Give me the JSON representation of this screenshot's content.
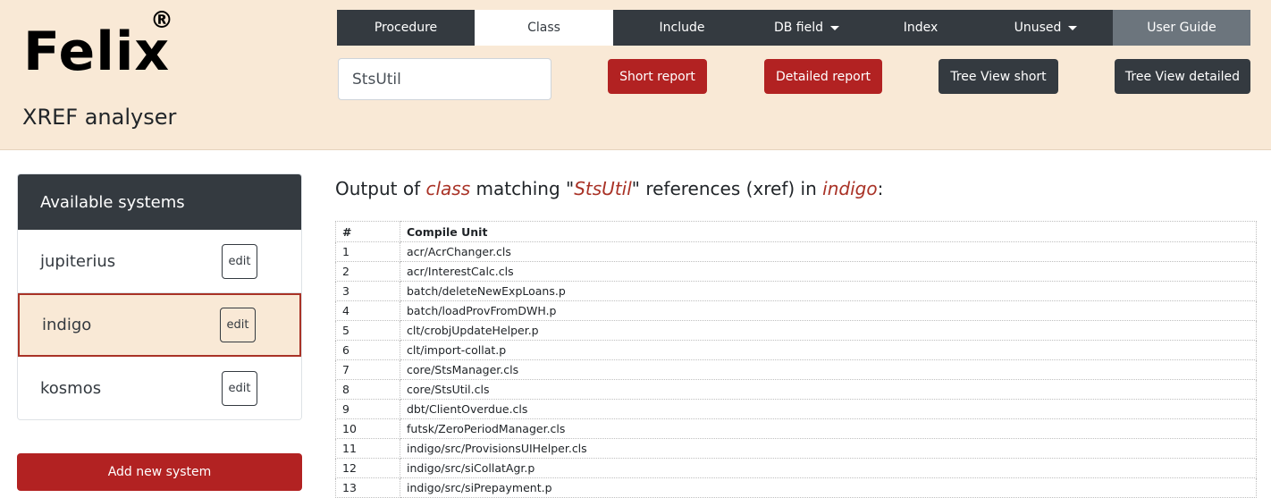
{
  "app": {
    "name": "Felix",
    "reg_mark": "®",
    "subtitle": "XREF analyser"
  },
  "nav": {
    "tabs": [
      {
        "label": "Procedure"
      },
      {
        "label": "Class"
      },
      {
        "label": "Include"
      },
      {
        "label": "DB field"
      },
      {
        "label": "Index"
      },
      {
        "label": "Unused"
      },
      {
        "label": "User Guide"
      }
    ],
    "active": "Class"
  },
  "search": {
    "value": "StsUtil",
    "placeholder": ""
  },
  "actions": {
    "short_report": "Short report",
    "detailed_report": "Detailed report",
    "tree_short": "Tree View short",
    "tree_detailed": "Tree View detailed"
  },
  "sidebar": {
    "title": "Available systems",
    "items": [
      {
        "name": "jupiterius",
        "edit": "edit"
      },
      {
        "name": "indigo",
        "edit": "edit"
      },
      {
        "name": "kosmos",
        "edit": "edit"
      }
    ],
    "selected": "indigo",
    "add_label": "Add new system"
  },
  "output": {
    "prefix": "Output of ",
    "type": "class",
    "mid1": " matching \"",
    "term": "StsUtil",
    "mid2": "\" references (xref) in ",
    "system": "indigo",
    "suffix": ":"
  },
  "table": {
    "headers": [
      "#",
      "Compile Unit"
    ],
    "rows": [
      [
        "1",
        "acr/AcrChanger.cls"
      ],
      [
        "2",
        "acr/InterestCalc.cls"
      ],
      [
        "3",
        "batch/deleteNewExpLoans.p"
      ],
      [
        "4",
        "batch/loadProvFromDWH.p"
      ],
      [
        "5",
        "clt/crobjUpdateHelper.p"
      ],
      [
        "6",
        "clt/import-collat.p"
      ],
      [
        "7",
        "core/StsManager.cls"
      ],
      [
        "8",
        "core/StsUtil.cls"
      ],
      [
        "9",
        "dbt/ClientOverdue.cls"
      ],
      [
        "10",
        "futsk/ZeroPeriodManager.cls"
      ],
      [
        "11",
        "indigo/src/ProvisionsUIHelper.cls"
      ],
      [
        "12",
        "indigo/src/siCollatAgr.p"
      ],
      [
        "13",
        "indigo/src/siPrepayment.p"
      ]
    ]
  },
  "colors": {
    "header_bg": "#f9e9d6",
    "dark": "#343a40",
    "accent_red": "#b22222",
    "highlight": "#a93226"
  }
}
